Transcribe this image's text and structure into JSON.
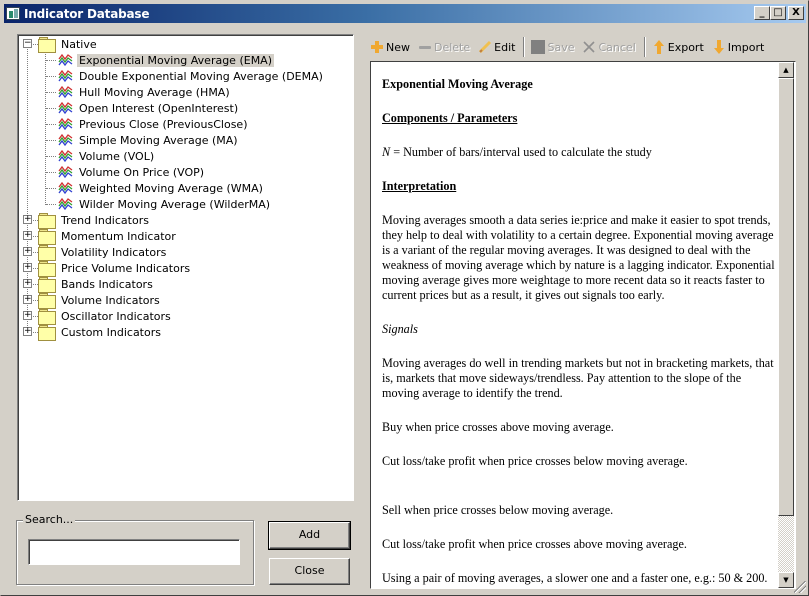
{
  "window": {
    "title": "Indicator Database",
    "controls": {
      "minimize": "_",
      "maximize": "□",
      "close": "X"
    }
  },
  "tree": {
    "native": {
      "label": "Native",
      "expanded": true,
      "items": [
        {
          "label": "Exponential Moving Average (EMA)",
          "selected": true
        },
        {
          "label": "Double Exponential Moving Average (DEMA)"
        },
        {
          "label": "Hull Moving Average (HMA)"
        },
        {
          "label": "Open Interest (OpenInterest)"
        },
        {
          "label": "Previous Close (PreviousClose)"
        },
        {
          "label": "Simple Moving Average (MA)"
        },
        {
          "label": "Volume (VOL)"
        },
        {
          "label": "Volume On Price (VOP)"
        },
        {
          "label": "Weighted Moving Average (WMA)"
        },
        {
          "label": "Wilder Moving Average (WilderMA)"
        }
      ]
    },
    "folders": [
      {
        "label": "Trend Indicators"
      },
      {
        "label": "Momentum Indicator"
      },
      {
        "label": "Volatility Indicators"
      },
      {
        "label": "Price Volume Indicators"
      },
      {
        "label": "Bands Indicators"
      },
      {
        "label": "Volume Indicators"
      },
      {
        "label": "Oscillator Indicators"
      },
      {
        "label": "Custom Indicators"
      }
    ]
  },
  "search": {
    "group_label": "Search...",
    "value": "",
    "placeholder": ""
  },
  "buttons": {
    "add": "Add",
    "close": "Close"
  },
  "toolbar": {
    "new": "New",
    "delete": "Delete",
    "edit": "Edit",
    "save": "Save",
    "cancel": "Cancel",
    "export": "Export",
    "import": "Import"
  },
  "document": {
    "title": "Exponential Moving Average",
    "components_heading": "Components / Parameters",
    "param_symbol": "N",
    "param_text": " = Number of bars/interval used to calculate the study",
    "interpretation_heading": "Interpretation",
    "interpretation_text": "Moving averages smooth a data series ie:price and make it easier to spot trends, they help to deal with volatility to a certain degree. Exponential moving average is a variant of the regular moving averages. It was designed to deal with the weakness of moving average which by nature is a lagging indicator. Exponential moving average gives more weightage to more recent data so it reacts faster to current prices but as a result, it gives out signals too early.",
    "signals_heading": "Signals",
    "signals_text": "Moving averages do well in trending markets but not in bracketing markets, that is, markets that move sideways/trendless. Pay attention to the slope of the moving average to identify the trend.",
    "buy": "Buy when price crosses above moving average.",
    "buy_exit": "Cut loss/take profit when price crosses below moving average.",
    "sell": "Sell when price crosses below moving average.",
    "sell_exit": "Cut loss/take profit when price crosses above moving average.",
    "pair": "Using a pair of moving averages, a slower one and a faster one, e.g.: 50 & 200."
  },
  "scrollbar": {
    "position_fraction": 0.0
  }
}
